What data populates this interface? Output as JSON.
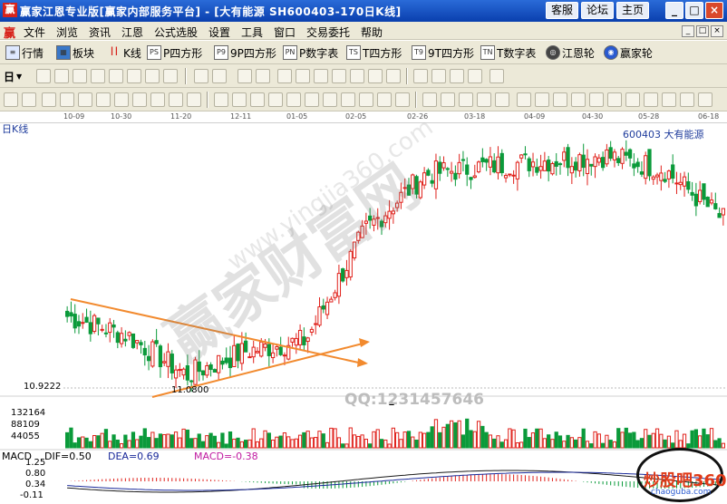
{
  "window": {
    "title": "赢家江恩专业版[赢家内部服务平台] - [大有能源   SH600403-170日K线]",
    "logo": "赢",
    "right_buttons": [
      "客服",
      "论坛",
      "主页"
    ],
    "controls": [
      "_",
      "□",
      "×"
    ]
  },
  "menu": {
    "logo": "赢",
    "items": [
      "文件",
      "浏览",
      "资讯",
      "江恩",
      "公式选股",
      "设置",
      "工具",
      "窗口",
      "交易委托",
      "帮助"
    ],
    "mdi_controls": [
      "_",
      "□",
      "×"
    ]
  },
  "toolbar1": {
    "items": [
      {
        "label": "行情",
        "icon": "quote-icon"
      },
      {
        "label": "板块",
        "icon": "sector-icon"
      },
      {
        "label": "K线",
        "icon": "kline-icon"
      },
      {
        "label": "P四方形",
        "icon_text": "PS"
      },
      {
        "label": "9P四方形",
        "icon_text": "P9"
      },
      {
        "label": "P数字表",
        "icon_text": "PN"
      },
      {
        "label": "T四方形",
        "icon_text": "TS"
      },
      {
        "label": "9T四方形",
        "icon_text": "T9"
      },
      {
        "label": "T数字表",
        "icon_text": "TN"
      },
      {
        "label": "江恩轮",
        "icon": "gann-wheel-icon"
      },
      {
        "label": "赢家轮",
        "icon": "winner-wheel-icon"
      }
    ]
  },
  "toolbar2": {
    "period": "日"
  },
  "chart": {
    "period_label": "日K线",
    "stock_label": "600403 大有能源",
    "date_ticks": [
      "10-09",
      "10-30",
      "11-20",
      "12-11",
      "01-05",
      "02-05",
      "02-26",
      "03-18",
      "04-09",
      "04-30",
      "05-28",
      "06-18"
    ],
    "price_low_label": "10.9222",
    "low_point_label": "11.0800",
    "volume_ticks": [
      "132164",
      "88109",
      "44055"
    ],
    "qq_text": "QQ:1231457646",
    "macd": {
      "title": "MACD",
      "dif": "DIF=0.50",
      "dea": "DEA=0.69",
      "macd": "MACD=-0.38",
      "ticks": [
        "1.25",
        "0.80",
        "0.34",
        "-0.11"
      ]
    },
    "colors": {
      "up": "#e0211b",
      "down": "#0a9a3a",
      "pattern": "#f28a2e",
      "dif": "#1a1a1a",
      "dea": "#1a2a9a"
    }
  },
  "chart_data": {
    "type": "candlestick",
    "x": [
      "10-09",
      "10-30",
      "11-20",
      "12-11",
      "01-05",
      "02-05",
      "02-26",
      "03-18",
      "04-09",
      "04-30",
      "05-28",
      "06-18"
    ],
    "close": [
      13.6,
      12.9,
      11.4,
      12.3,
      12.7,
      16.8,
      18.9,
      19.2,
      19.4,
      19.6,
      19.1,
      17.2
    ],
    "ylabel": "",
    "ylim": [
      10.9222,
      20.6
    ]
  },
  "watermark": {
    "main": "赢家财富网",
    "url": "www.yingjia360.com",
    "logo": "炒股吧360",
    "logo_sub": "chaoguba.com"
  }
}
